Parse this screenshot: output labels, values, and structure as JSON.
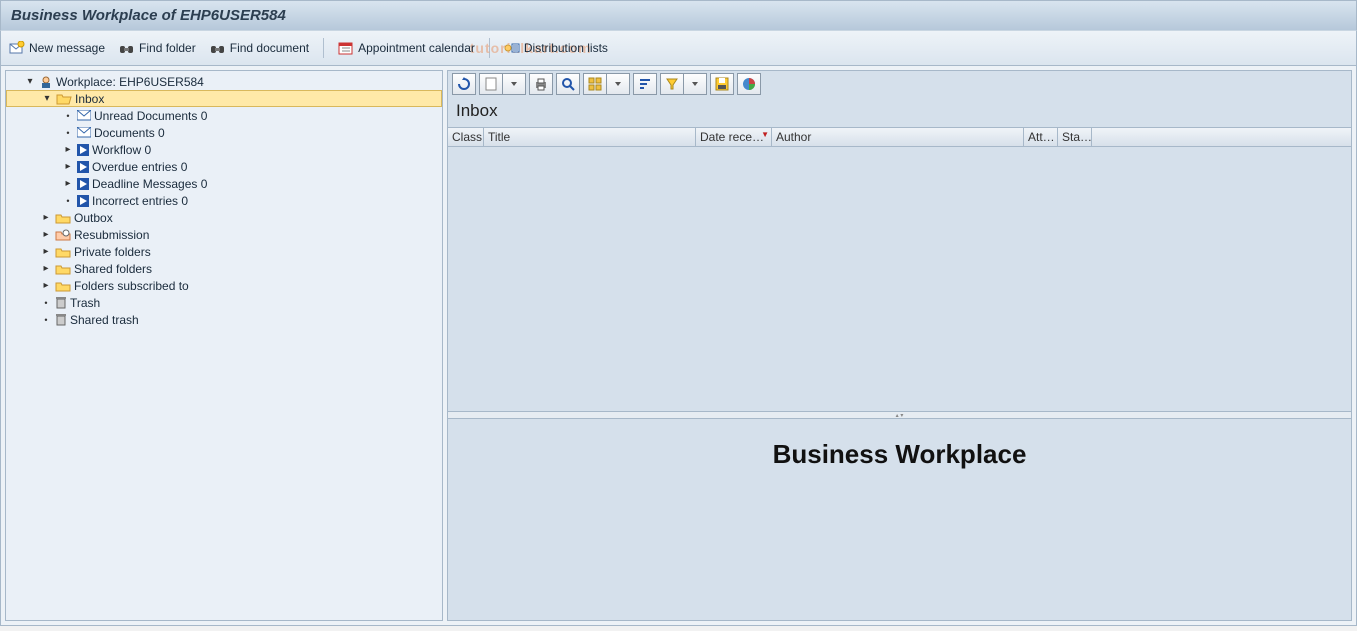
{
  "title": "Business Workplace of EHP6USER584",
  "toolbar": {
    "new_message": "New message",
    "find_folder": "Find folder",
    "find_document": "Find document",
    "appointment_calendar": "Appointment calendar",
    "distribution_lists": "Distribution lists"
  },
  "tree": {
    "root": "Workplace: EHP6USER584",
    "inbox": "Inbox",
    "inbox_children": {
      "unread": "Unread Documents 0",
      "documents": "Documents 0",
      "workflow": "Workflow 0",
      "overdue": "Overdue entries 0",
      "deadline": "Deadline Messages 0",
      "incorrect": "Incorrect entries 0"
    },
    "outbox": "Outbox",
    "resubmission": "Resubmission",
    "private_folders": "Private folders",
    "shared_folders": "Shared folders",
    "folders_subscribed": "Folders subscribed to",
    "trash": "Trash",
    "shared_trash": "Shared trash"
  },
  "list": {
    "title": "Inbox",
    "columns": {
      "class": "Class",
      "title": "Title",
      "date": "Date rece…",
      "author": "Author",
      "att": "Att…",
      "sta": "Sta…"
    }
  },
  "preview": {
    "title": "Business Workplace"
  }
}
